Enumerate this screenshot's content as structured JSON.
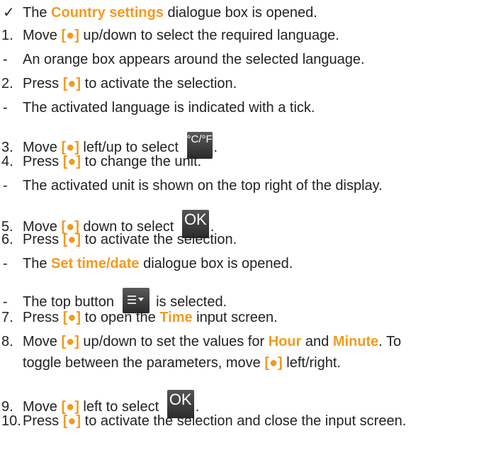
{
  "markers": {
    "check": "✓",
    "dash": "-"
  },
  "button_symbol": "[●]",
  "lines": [
    {
      "marker": "✓",
      "parts": [
        "The ",
        "Country settings",
        " dialogue box is opened."
      ]
    },
    {
      "marker": "1.",
      "parts": [
        "Move ",
        "[●]",
        " up/down to select the required language."
      ]
    },
    {
      "marker": "-",
      "parts": [
        "An orange box appears around the selected language."
      ]
    },
    {
      "marker": "2.",
      "parts": [
        "Press ",
        "[●]",
        " to activate the selection."
      ]
    },
    {
      "marker": "-",
      "parts": [
        "The activated language is indicated with a tick."
      ]
    },
    {
      "marker": "3.",
      "parts": [
        "Move ",
        "[●]",
        " left/up to select ",
        "."
      ]
    },
    {
      "marker": "4.",
      "parts": [
        "Press ",
        "[●]",
        " to change the unit."
      ]
    },
    {
      "marker": "-",
      "parts": [
        "The activated unit is shown on the top right of the display."
      ]
    },
    {
      "marker": "5.",
      "parts": [
        "Move ",
        "[●]",
        " down to select ",
        "."
      ]
    },
    {
      "marker": "6.",
      "parts": [
        "Press ",
        "[●]",
        " to activate the selection."
      ]
    },
    {
      "marker": "-",
      "parts": [
        "The ",
        "Set time/date",
        " dialogue box is opened."
      ]
    },
    {
      "marker": "-",
      "parts": [
        "The top button ",
        " is selected."
      ]
    },
    {
      "marker": "7.",
      "parts": [
        "Press ",
        "[●]",
        " to open the ",
        "Time",
        " input screen."
      ]
    },
    {
      "marker": "8.",
      "parts": [
        "Move ",
        "[●]",
        " up/down to set the values for ",
        "Hour",
        " and ",
        "Minute",
        ". To"
      ]
    },
    {
      "marker": "",
      "parts": [
        "toggle between the parameters, move ",
        "[●]",
        " left/right."
      ]
    },
    {
      "marker": "9.",
      "parts": [
        "Move ",
        "[●]",
        " left to select ",
        "."
      ]
    },
    {
      "marker": "10.",
      "parts": [
        "Press ",
        "[●]",
        " to activate the selection and close the input screen."
      ]
    }
  ],
  "icons": {
    "unit_icon_label": "°C/°F",
    "ok_icon_label": "OK",
    "menu_icon_name": "menu-dropdown-icon"
  },
  "colors": {
    "highlight": "#f39a1e",
    "text": "#222222",
    "icon_bg": "#3a3a3a"
  }
}
